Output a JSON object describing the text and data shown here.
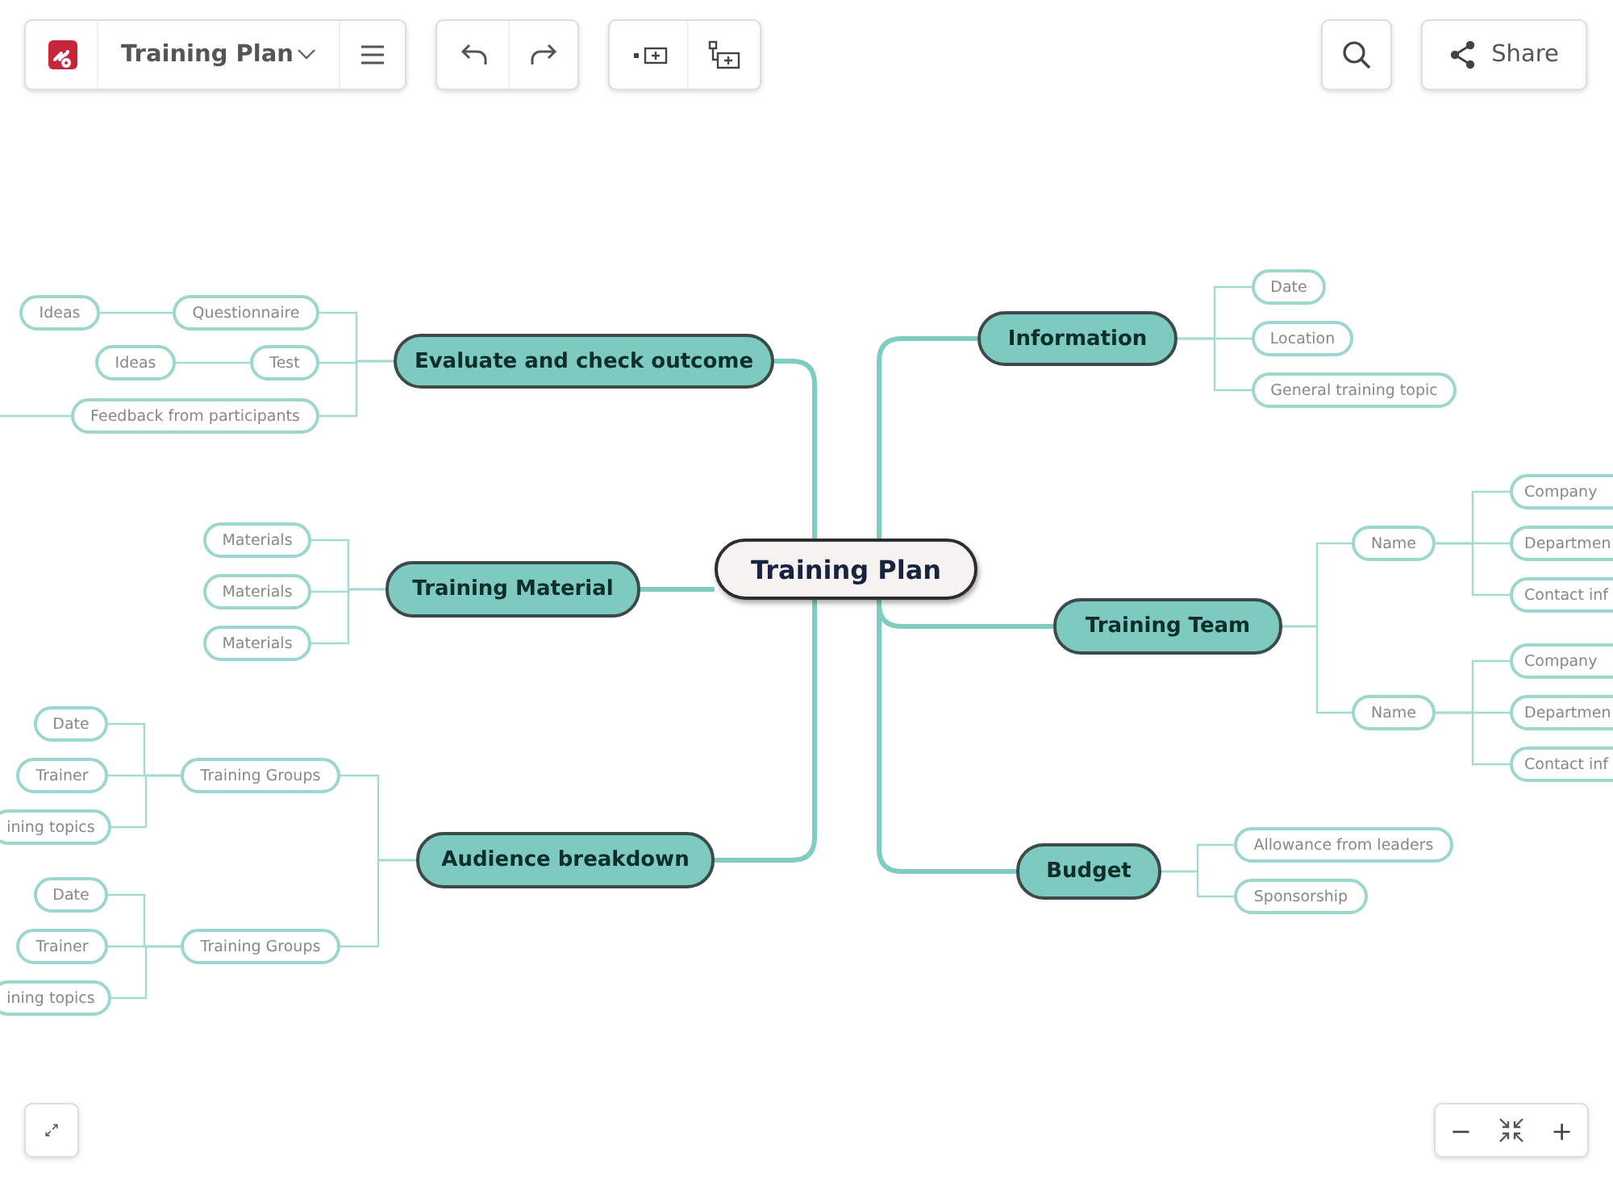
{
  "toolbar": {
    "title": "Training Plan"
  },
  "share_button": {
    "label": "Share"
  },
  "zoom_controls": {
    "zoom_out": "−",
    "zoom_in": "+"
  },
  "mind_map": {
    "root": "Training Plan",
    "branches": [
      {
        "label": "Information",
        "children": [
          {
            "label": "Date"
          },
          {
            "label": "Location"
          },
          {
            "label": "General training topic"
          }
        ]
      },
      {
        "label": "Training Team",
        "children": [
          {
            "label": "Name",
            "children": [
              {
                "label": "Company"
              },
              {
                "label": "Departmen"
              },
              {
                "label": "Contact inf"
              }
            ]
          },
          {
            "label": "Name",
            "children": [
              {
                "label": "Company"
              },
              {
                "label": "Departmen"
              },
              {
                "label": "Contact inf"
              }
            ]
          }
        ]
      },
      {
        "label": "Budget",
        "children": [
          {
            "label": "Allowance from leaders"
          },
          {
            "label": "Sponsorship"
          }
        ]
      },
      {
        "label": "Evaluate and check outcome",
        "children": [
          {
            "label": "Questionnaire",
            "children": [
              {
                "label": "Ideas"
              }
            ]
          },
          {
            "label": "Test",
            "children": [
              {
                "label": "Ideas"
              }
            ]
          },
          {
            "label": "Feedback from participants"
          }
        ]
      },
      {
        "label": "Training Material",
        "children": [
          {
            "label": "Materials"
          },
          {
            "label": "Materials"
          },
          {
            "label": "Materials"
          }
        ]
      },
      {
        "label": "Audience breakdown",
        "children": [
          {
            "label": "Training Groups",
            "children": [
              {
                "label": "Date"
              },
              {
                "label": "Trainer"
              },
              {
                "label": "ining topics"
              }
            ]
          },
          {
            "label": "Training Groups",
            "children": [
              {
                "label": "Date"
              },
              {
                "label": "Trainer"
              },
              {
                "label": "ining topics"
              }
            ]
          }
        ]
      }
    ]
  }
}
